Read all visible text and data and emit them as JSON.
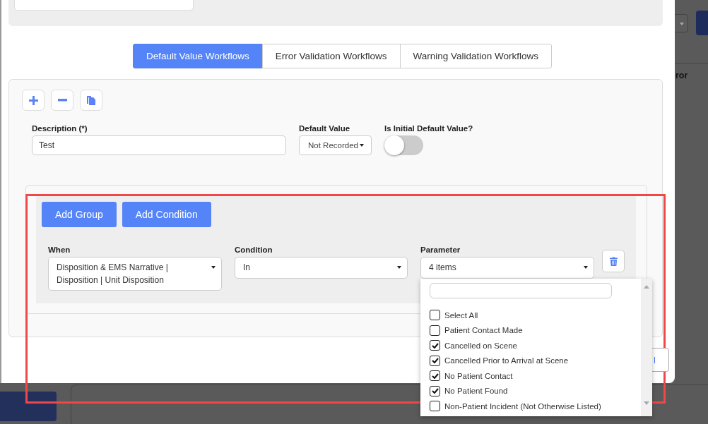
{
  "backdrop": {
    "column_text": "ror",
    "button_text": "l"
  },
  "tabs": [
    {
      "label": "Default Value Workflows",
      "selected": true
    },
    {
      "label": "Error Validation Workflows",
      "selected": false
    },
    {
      "label": "Warning Validation Workflows",
      "selected": false
    }
  ],
  "form": {
    "description": {
      "label": "Description (*)",
      "value": "Test"
    },
    "default_value": {
      "label": "Default Value",
      "value": "Not Recorded"
    },
    "initial_default": {
      "label": "Is Initial Default Value?",
      "on": false
    }
  },
  "rule": {
    "buttons": [
      "Add Group",
      "Add Condition"
    ],
    "fields": [
      {
        "label": "When",
        "value": "Disposition & EMS Narrative | Disposition | Unit Disposition"
      },
      {
        "label": "Condition",
        "value": "In"
      },
      {
        "label": "Parameter",
        "value": "4 items"
      }
    ],
    "options": [
      {
        "label": "Select All",
        "checked": false
      },
      {
        "label": "Patient Contact Made",
        "checked": false
      },
      {
        "label": "Cancelled on Scene",
        "checked": true
      },
      {
        "label": "Cancelled Prior to Arrival at Scene",
        "checked": true
      },
      {
        "label": "No Patient Contact",
        "checked": true
      },
      {
        "label": "No Patient Found",
        "checked": true
      },
      {
        "label": "Non-Patient Incident (Not Otherwise Listed)",
        "checked": false
      }
    ]
  }
}
